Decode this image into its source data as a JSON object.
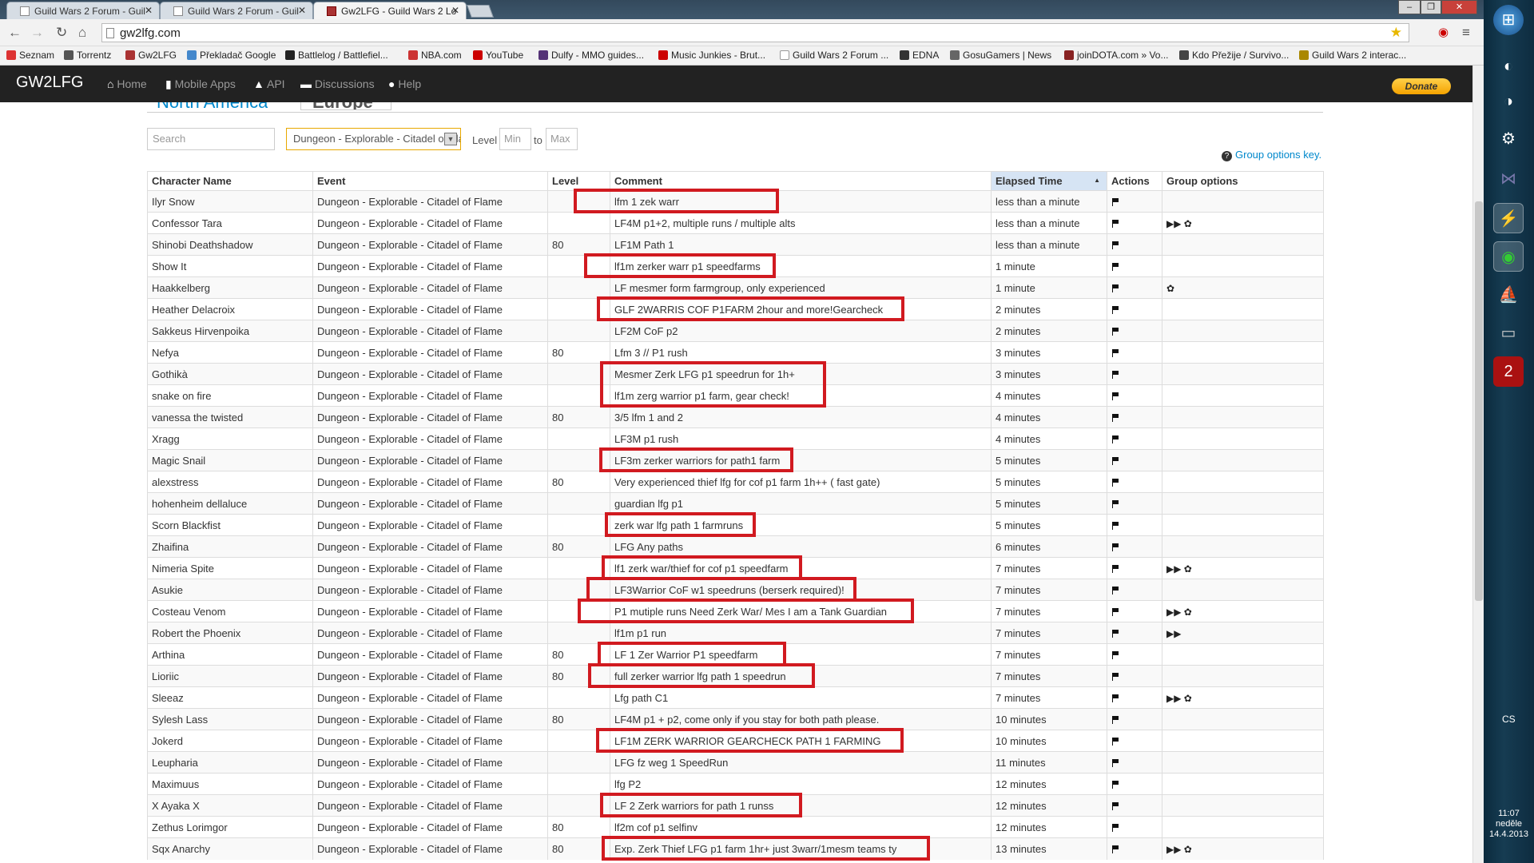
{
  "browser": {
    "tabs": [
      {
        "title": "Guild Wars 2 Forum - Guil"
      },
      {
        "title": "Guild Wars 2 Forum - Guil"
      },
      {
        "title": "Gw2LFG - Guild Wars 2 Lo"
      }
    ],
    "url": "gw2lfg.com",
    "bookmarks": [
      "Seznam",
      "Torrentz",
      "Gw2LFG",
      "Překladač Google",
      "Battlelog / Battlefiel...",
      "NBA.com",
      "YouTube",
      "Dulfy - MMO guides...",
      "Music Junkies - Brut...",
      "Guild Wars 2 Forum ...",
      "EDNA",
      "GosuGamers | News",
      "joinDOTA.com » Vo...",
      "Kdo Přežije / Survivo...",
      "Guild Wars 2 interac..."
    ]
  },
  "site": {
    "brand": "GW2LFG",
    "nav": [
      "Home",
      "Mobile Apps",
      "API",
      "Discussions",
      "Help"
    ],
    "donate": "Donate",
    "regions": [
      "North America",
      "Europe"
    ]
  },
  "filters": {
    "search_placeholder": "Search",
    "event_selected": "Dungeon - Explorable - Citadel of Flame",
    "level_label": "Level",
    "min_placeholder": "Min",
    "to_label": "to",
    "max_placeholder": "Max",
    "group_options_key": "Group options key."
  },
  "table": {
    "headers": [
      "Character Name",
      "Event",
      "Level",
      "Comment",
      "Elapsed Time",
      "Actions",
      "Group options"
    ],
    "sorted_column": "Elapsed Time",
    "rows": [
      {
        "name": "Ilyr Snow",
        "event": "Dungeon - Explorable - Citadel of Flame",
        "level": "",
        "comment": "lfm 1 zek warr",
        "time": "less than a minute",
        "opts": ""
      },
      {
        "name": "Confessor Tara",
        "event": "Dungeon - Explorable - Citadel of Flame",
        "level": "",
        "comment": "LF4M p1+2, multiple runs / multiple alts",
        "time": "less than a minute",
        "opts": "▶▶ ✿"
      },
      {
        "name": "Shinobi Deathshadow",
        "event": "Dungeon - Explorable - Citadel of Flame",
        "level": "80",
        "comment": "LF1M Path 1",
        "time": "less than a minute",
        "opts": ""
      },
      {
        "name": "Show It",
        "event": "Dungeon - Explorable - Citadel of Flame",
        "level": "",
        "comment": "lf1m zerker warr p1 speedfarms",
        "time": "1 minute",
        "opts": ""
      },
      {
        "name": "Haakkelberg",
        "event": "Dungeon - Explorable - Citadel of Flame",
        "level": "",
        "comment": "LF mesmer form farmgroup, only experienced",
        "time": "1 minute",
        "opts": "✿"
      },
      {
        "name": "Heather Delacroix",
        "event": "Dungeon - Explorable - Citadel of Flame",
        "level": "",
        "comment": "GLF 2WARRIS COF P1FARM 2hour and more!Gearcheck",
        "time": "2 minutes",
        "opts": ""
      },
      {
        "name": "Sakkeus Hirvenpoika",
        "event": "Dungeon - Explorable - Citadel of Flame",
        "level": "",
        "comment": "LF2M CoF p2",
        "time": "2 minutes",
        "opts": ""
      },
      {
        "name": "Nefya",
        "event": "Dungeon - Explorable - Citadel of Flame",
        "level": "80",
        "comment": "Lfm 3 // P1 rush",
        "time": "3 minutes",
        "opts": ""
      },
      {
        "name": "Gothikà",
        "event": "Dungeon - Explorable - Citadel of Flame",
        "level": "",
        "comment": "Mesmer Zerk LFG p1 speedrun for 1h+",
        "time": "3 minutes",
        "opts": ""
      },
      {
        "name": "snake on fire",
        "event": "Dungeon - Explorable - Citadel of Flame",
        "level": "",
        "comment": "lf1m zerg warrior p1 farm, gear check!",
        "time": "4 minutes",
        "opts": ""
      },
      {
        "name": "vanessa the twisted",
        "event": "Dungeon - Explorable - Citadel of Flame",
        "level": "80",
        "comment": "3/5 lfm 1 and 2",
        "time": "4 minutes",
        "opts": ""
      },
      {
        "name": "Xragg",
        "event": "Dungeon - Explorable - Citadel of Flame",
        "level": "",
        "comment": "LF3M p1 rush",
        "time": "4 minutes",
        "opts": ""
      },
      {
        "name": "Magic Snail",
        "event": "Dungeon - Explorable - Citadel of Flame",
        "level": "",
        "comment": "LF3m zerker warriors for path1 farm",
        "time": "5 minutes",
        "opts": ""
      },
      {
        "name": "alexstress",
        "event": "Dungeon - Explorable - Citadel of Flame",
        "level": "80",
        "comment": "Very experienced thief lfg for cof p1 farm 1h++ ( fast gate)",
        "time": "5 minutes",
        "opts": ""
      },
      {
        "name": "hohenheim dellaluce",
        "event": "Dungeon - Explorable - Citadel of Flame",
        "level": "",
        "comment": "guardian lfg p1",
        "time": "5 minutes",
        "opts": ""
      },
      {
        "name": "Scorn Blackfist",
        "event": "Dungeon - Explorable - Citadel of Flame",
        "level": "",
        "comment": "zerk war lfg path 1 farmruns",
        "time": "5 minutes",
        "opts": ""
      },
      {
        "name": "Zhaifina",
        "event": "Dungeon - Explorable - Citadel of Flame",
        "level": "80",
        "comment": "LFG Any paths",
        "time": "6 minutes",
        "opts": ""
      },
      {
        "name": "Nimeria Spite",
        "event": "Dungeon - Explorable - Citadel of Flame",
        "level": "",
        "comment": "lf1 zerk war/thief for cof p1 speedfarm",
        "time": "7 minutes",
        "opts": "▶▶ ✿"
      },
      {
        "name": "Asukie",
        "event": "Dungeon - Explorable - Citadel of Flame",
        "level": "",
        "comment": "LF3Warrior CoF w1 speedruns (berserk required)!",
        "time": "7 minutes",
        "opts": ""
      },
      {
        "name": "Costeau Venom",
        "event": "Dungeon - Explorable - Citadel of Flame",
        "level": "",
        "comment": "P1 mutiple runs Need Zerk War/ Mes I am a Tank Guardian",
        "time": "7 minutes",
        "opts": "▶▶ ✿"
      },
      {
        "name": "Robert the Phoenix",
        "event": "Dungeon - Explorable - Citadel of Flame",
        "level": "",
        "comment": "lf1m p1 run",
        "time": "7 minutes",
        "opts": "▶▶"
      },
      {
        "name": "Arthina",
        "event": "Dungeon - Explorable - Citadel of Flame",
        "level": "80",
        "comment": "LF 1 Zer Warrior P1 speedfarm",
        "time": "7 minutes",
        "opts": ""
      },
      {
        "name": "Lioriic",
        "event": "Dungeon - Explorable - Citadel of Flame",
        "level": "80",
        "comment": "full zerker warrior lfg path 1 speedrun",
        "time": "7 minutes",
        "opts": ""
      },
      {
        "name": "Sleeaz",
        "event": "Dungeon - Explorable - Citadel of Flame",
        "level": "",
        "comment": "Lfg path C1",
        "time": "7 minutes",
        "opts": "▶▶ ✿"
      },
      {
        "name": "Sylesh Lass",
        "event": "Dungeon - Explorable - Citadel of Flame",
        "level": "80",
        "comment": "LF4M p1 + p2, come only if you stay for both path please.",
        "time": "10 minutes",
        "opts": ""
      },
      {
        "name": "Jokerd",
        "event": "Dungeon - Explorable - Citadel of Flame",
        "level": "",
        "comment": "LF1M ZERK WARRIOR GEARCHECK PATH 1 FARMING",
        "time": "10 minutes",
        "opts": ""
      },
      {
        "name": "Leupharia",
        "event": "Dungeon - Explorable - Citadel of Flame",
        "level": "",
        "comment": "LFG fz weg 1 SpeedRun",
        "time": "11 minutes",
        "opts": ""
      },
      {
        "name": "Maximuus",
        "event": "Dungeon - Explorable - Citadel of Flame",
        "level": "",
        "comment": "lfg P2",
        "time": "12 minutes",
        "opts": ""
      },
      {
        "name": "X Ayaka X",
        "event": "Dungeon - Explorable - Citadel of Flame",
        "level": "",
        "comment": "LF 2 Zerk warriors for path 1 runss",
        "time": "12 minutes",
        "opts": ""
      },
      {
        "name": "Zethus Lorimgor",
        "event": "Dungeon - Explorable - Citadel of Flame",
        "level": "80",
        "comment": "lf2m cof p1 selfinv",
        "time": "12 minutes",
        "opts": ""
      },
      {
        "name": "Sqx Anarchy",
        "event": "Dungeon - Explorable - Citadel of Flame",
        "level": "80",
        "comment": "Exp. Zerk Thief LFG p1 farm 1hr+ just 3warr/1mesm teams ty",
        "time": "13 minutes",
        "opts": "▶▶ ✿"
      }
    ]
  },
  "system": {
    "lang": "CS",
    "time": "11:07",
    "day": "neděle",
    "date": "14.4.2013"
  },
  "colors": {
    "highlight": "#d11a20",
    "navbar": "#222222",
    "donate": "#f5a300"
  }
}
